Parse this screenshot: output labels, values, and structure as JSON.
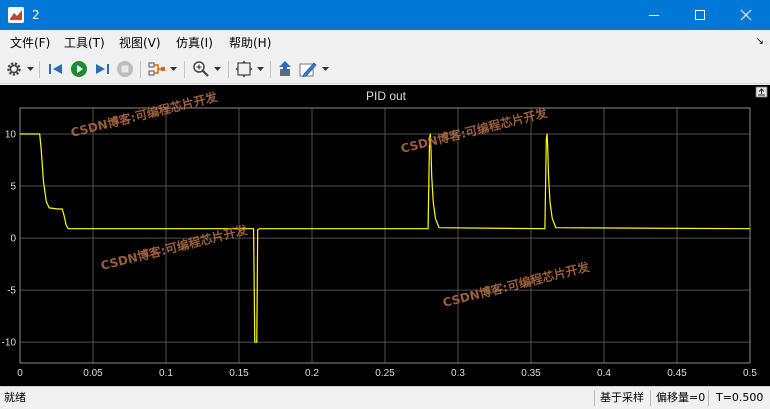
{
  "window": {
    "title": "2"
  },
  "menu": [
    {
      "label": "文件(F)"
    },
    {
      "label": "工具(T)"
    },
    {
      "label": "视图(V)"
    },
    {
      "label": "仿真(I)"
    },
    {
      "label": "帮助(H)"
    }
  ],
  "toolbar_icons": [
    "gear-icon",
    "step-back-icon",
    "run-icon",
    "step-forward-icon",
    "stop-icon",
    "highlight-signal-icon",
    "zoom-icon",
    "fit-to-view-icon",
    "save-axes-icon",
    "style-icon"
  ],
  "scope": {
    "plot_title": "PID out",
    "line_color": "#ffff00",
    "background_color": "#000000",
    "grid_color": "#505050"
  },
  "watermark": {
    "text": "CSDN博客:可编程芯片开发"
  },
  "status": {
    "ready": "就绪",
    "sample_based": "基于采样",
    "offset": "偏移量=0",
    "time": "T=0.500"
  },
  "chart_data": {
    "type": "line",
    "title": "PID out",
    "xlabel": "",
    "ylabel": "",
    "xlim": [
      0,
      0.5
    ],
    "ylim": [
      -12,
      12.5
    ],
    "x_ticks": [
      0,
      0.05,
      0.1,
      0.15,
      0.2,
      0.25,
      0.3,
      0.35,
      0.4,
      0.45,
      0.5
    ],
    "y_ticks": [
      10,
      5,
      0,
      -5,
      -10
    ],
    "grid": true,
    "series": [
      {
        "color": "#ffff00",
        "x": [
          0,
          0.0135,
          0.0145,
          0.016,
          0.018,
          0.02,
          0.026,
          0.029,
          0.0305,
          0.0315,
          0.033,
          0.16,
          0.1608,
          0.1612,
          0.1622,
          0.1628,
          0.164,
          0.2795,
          0.2805,
          0.281,
          0.2815,
          0.282,
          0.283,
          0.2845,
          0.287,
          0.3595,
          0.3605,
          0.361,
          0.3615,
          0.362,
          0.363,
          0.3645,
          0.367,
          0.5
        ],
        "y": [
          10,
          10,
          8.5,
          5.5,
          3.5,
          2.9,
          2.8,
          2.8,
          2.0,
          1.3,
          0.9,
          0.9,
          -10,
          -10,
          -10,
          0.8,
          0.9,
          0.9,
          9.5,
          10,
          8.5,
          6,
          3.5,
          1.9,
          1.0,
          0.9,
          9.5,
          10,
          8.5,
          6,
          3.5,
          1.9,
          1.0,
          0.9
        ]
      }
    ]
  }
}
